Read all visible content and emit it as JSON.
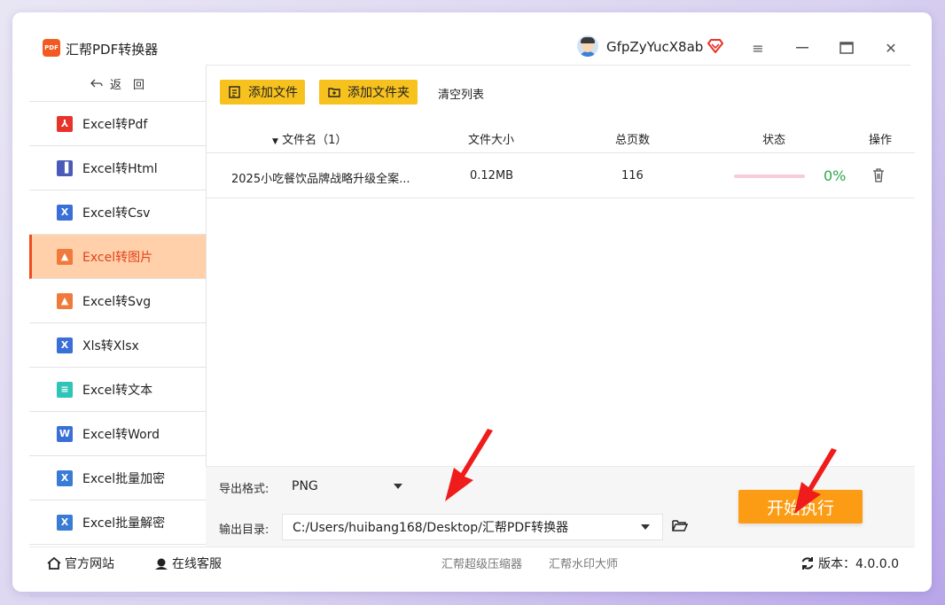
{
  "app": {
    "logo_text": "PDF",
    "title": "汇帮PDF转换器",
    "username": "GfpZyYucX8ab"
  },
  "window_controls": {
    "menu": "≡",
    "maximize": "▭",
    "close": "✕"
  },
  "sidebar": {
    "back_label": "返　回",
    "items": [
      {
        "label": "Excel转Pdf",
        "icon": "pdf-icon",
        "color": "#e8332a"
      },
      {
        "label": "Excel转Html",
        "icon": "html-icon",
        "color": "#4a5ab8"
      },
      {
        "label": "Excel转Csv",
        "icon": "excel-x-icon",
        "color": "#3a6fd8"
      },
      {
        "label": "Excel转图片",
        "icon": "image-icon",
        "color": "#f07a3c",
        "active": true
      },
      {
        "label": "Excel转Svg",
        "icon": "image-icon",
        "color": "#f07a3c"
      },
      {
        "label": "Xls转Xlsx",
        "icon": "excel-x-icon",
        "color": "#3a6fd8"
      },
      {
        "label": "Excel转文本",
        "icon": "text-doc-icon",
        "color": "#2ec4b6"
      },
      {
        "label": "Excel转Word",
        "icon": "word-icon",
        "color": "#3a6fd8"
      },
      {
        "label": "Excel批量加密",
        "icon": "excel-book-icon",
        "color": "#3a7bd5"
      },
      {
        "label": "Excel批量解密",
        "icon": "excel-book-icon",
        "color": "#3a7bd5"
      }
    ]
  },
  "toolbar": {
    "add_file": "添加文件",
    "add_folder": "添加文件夹",
    "clear_list": "清空列表"
  },
  "table": {
    "headers": {
      "filename": "文件名（1）",
      "filesize": "文件大小",
      "pages": "总页数",
      "status": "状态",
      "action": "操作"
    },
    "rows": [
      {
        "filename": "2025小吃餐饮品牌战略升级全案...",
        "size": "0.12MB",
        "pages": "116",
        "progress": 0,
        "progress_text": "0%"
      }
    ]
  },
  "output": {
    "format_label": "导出格式:",
    "format_value": "PNG",
    "dir_label": "输出目录:",
    "dir_value": "C:/Users/huibang168/Desktop/汇帮PDF转换器",
    "start_button": "开始执行"
  },
  "statusbar": {
    "website": "官方网站",
    "support": "在线客服",
    "link1": "汇帮超级压缩器",
    "link2": "汇帮水印大师",
    "version": "版本：4.0.0.0"
  },
  "colors": {
    "accent": "#f7c21e",
    "start": "#fb9c14",
    "active_bg": "#ffd0a9",
    "active_text": "#e2421a",
    "progress_ok": "#2da84a"
  }
}
